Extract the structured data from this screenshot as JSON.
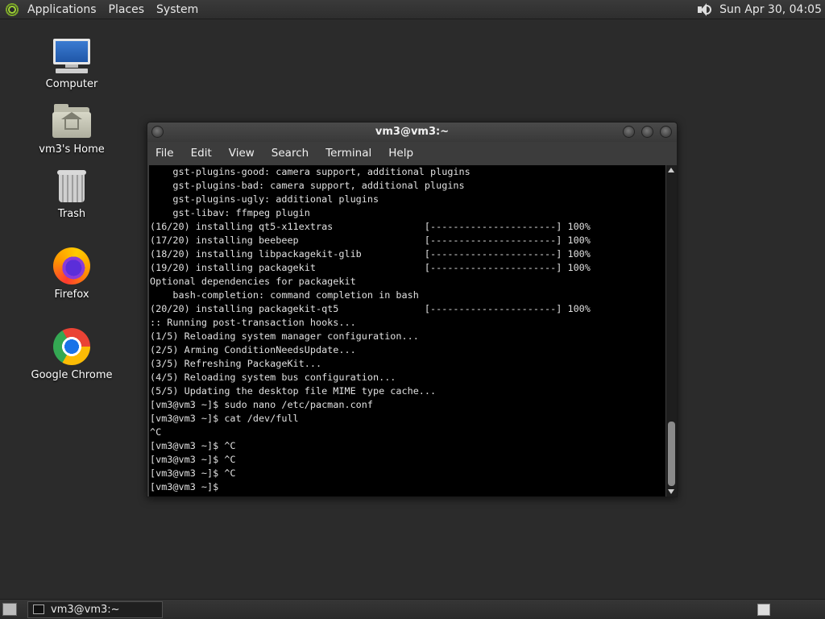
{
  "top_panel": {
    "menus": [
      "Applications",
      "Places",
      "System"
    ],
    "clock": "Sun Apr 30, 04:05"
  },
  "desktop": {
    "icons": [
      {
        "label": "Computer",
        "icon": "computer-icon"
      },
      {
        "label": "vm3's Home",
        "icon": "home-folder-icon"
      },
      {
        "label": "Trash",
        "icon": "trash-icon"
      },
      {
        "label": "Firefox",
        "icon": "firefox-icon"
      },
      {
        "label": "Google Chrome",
        "icon": "chrome-icon"
      }
    ]
  },
  "terminal": {
    "title": "vm3@vm3:~",
    "menu": [
      "File",
      "Edit",
      "View",
      "Search",
      "Terminal",
      "Help"
    ],
    "lines": [
      "    gst-plugins-good: camera support, additional plugins",
      "    gst-plugins-bad: camera support, additional plugins",
      "    gst-plugins-ugly: additional plugins",
      "    gst-libav: ffmpeg plugin",
      "(16/20) installing qt5-x11extras                [----------------------] 100%",
      "(17/20) installing beebeep                      [----------------------] 100%",
      "(18/20) installing libpackagekit-glib           [----------------------] 100%",
      "(19/20) installing packagekit                   [----------------------] 100%",
      "Optional dependencies for packagekit",
      "    bash-completion: command completion in bash",
      "(20/20) installing packagekit-qt5               [----------------------] 100%",
      ":: Running post-transaction hooks...",
      "(1/5) Reloading system manager configuration...",
      "(2/5) Arming ConditionNeedsUpdate...",
      "(3/5) Refreshing PackageKit...",
      "(4/5) Reloading system bus configuration...",
      "(5/5) Updating the desktop file MIME type cache...",
      "[vm3@vm3 ~]$ sudo nano /etc/pacman.conf",
      "[vm3@vm3 ~]$ cat /dev/full",
      "^C",
      "[vm3@vm3 ~]$ ^C",
      "[vm3@vm3 ~]$ ^C",
      "[vm3@vm3 ~]$ ^C",
      "[vm3@vm3 ~]$ "
    ]
  },
  "taskbar": {
    "tasks": [
      {
        "label": "vm3@vm3:~",
        "icon": "terminal-icon"
      }
    ]
  }
}
